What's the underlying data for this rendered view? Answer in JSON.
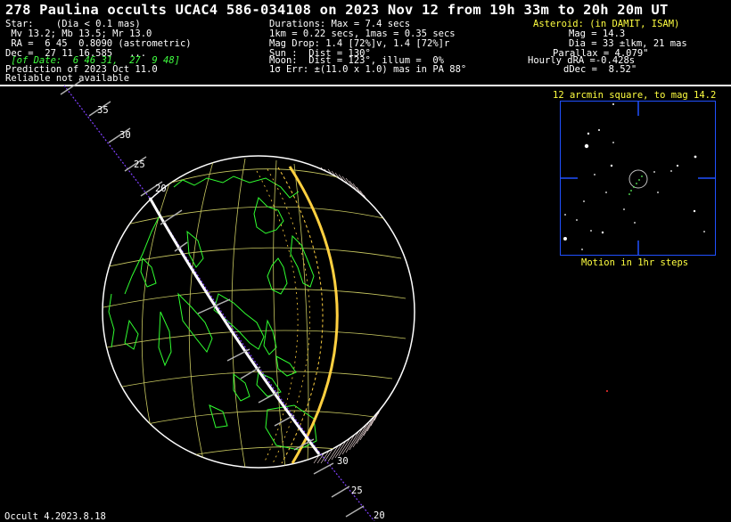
{
  "title": "278 Paulina occults UCAC4 586-034108 on 2023 Nov 12 from 19h 33m to 20h 20m UT",
  "star_block": {
    "line1": "Star:    (Dia < 0.1 mas)",
    "line2": " Mv 13.2; Mb 13.5; Mr 13.0",
    "line3": " RA =  6 45  0.8090 (astrometric)",
    "line4": "Dec =  27 11 16.585   ...",
    "line5": " [of Date:  6 46 31,  27  9 48]",
    "line6": "Prediction of 2023 Oct 11.0",
    "line7": "Reliable not available"
  },
  "event_block": {
    "line1": "Durations: Max = 7.4 secs",
    "line2": "1km = 0.22 secs, 1mas = 0.35 secs",
    "line3": "Mag Drop: 1.4 [72%]v, 1.4 [72%]r",
    "line4": "Sun :  Dist = 130°",
    "line5": "Moon:  Dist = 123°, illum =  0%",
    "line6": "1σ Err: ±(11.0 x 1.0) mas in PA 88°"
  },
  "asteroid_block": {
    "header": "Asteroid: (in DAMIT, ISAM)",
    "line1": "Mag = 14.3",
    "line2": "Dia = 33 ±lkm, 21 mas",
    "line3": "Parallax = 4.079\"",
    "line4": "Hourly dRA =-0.428s",
    "line5": "dDec =  8.52\""
  },
  "finder": {
    "title": "12 arcmin square, to mag 14.2",
    "caption": "Motion in 1hr steps"
  },
  "path_labels": [
    "35",
    "30",
    "25",
    "20",
    "30",
    "25",
    "20"
  ],
  "footer": "Occult 4.2023.8.18",
  "colors": {
    "text": "#ffffff",
    "highlight": "#ffff40",
    "coastline": "#30ff30",
    "graticule": "#c8c860",
    "terminator": "#ffd040",
    "path": "#ffffff",
    "center_line": "#8040ff",
    "finder_border": "#2050ff"
  }
}
